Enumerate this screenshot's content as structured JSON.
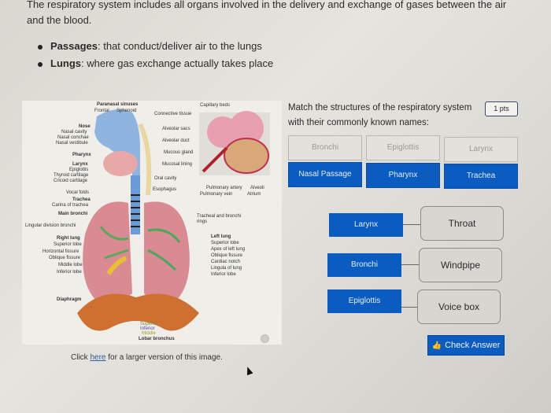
{
  "intro": {
    "paragraph": "The respiratory system includes all organs involved in the delivery and exchange of gases between the air and the blood.",
    "bullets": [
      {
        "term": "Passages",
        "text": ": that conduct/deliver air to the lungs"
      },
      {
        "term": "Lungs",
        "text": ": where gas exchange actually takes place"
      }
    ]
  },
  "diagram": {
    "labels": {
      "paranasal_sinuses": "Paranasal sinuses",
      "frontal": "Frontal",
      "sphenoid": "Sphenoid",
      "nose": "Nose",
      "nasal_cavity": "Nasal cavity",
      "nasal_conchae": "Nasal conchae",
      "nasal_vestibule": "Nasal vestibule",
      "pharynx": "Pharynx",
      "larynx": "Larynx",
      "epiglottis": "Epiglottis",
      "thyroid_cartilage": "Thyroid cartilage",
      "cricoid_cartilage": "Cricoid cartilage",
      "vocal_folds": "Vocal folds",
      "trachea": "Trachea",
      "carina": "Carina of trachea",
      "main_bronchi": "Main bronchi",
      "lingular_division": "Lingular division bronchi",
      "right_lung": "Right lung",
      "superior_lobe_r": "Superior lobe",
      "horizontal_fissure": "Horizontal fissure",
      "oblique_fissure_r": "Oblique fissure",
      "middle_lobe": "Middle lobe",
      "inferior_lobe_r": "Inferior lobe",
      "diaphragm": "Diaphragm",
      "connective_tissue": "Connective tissue",
      "alveolar_sacs": "Alveolar sacs",
      "alveolar_duct": "Alveolar duct",
      "mucous_gland": "Mucous gland",
      "mucosal_lining": "Mucosal lining",
      "oral_cavity": "Oral cavity",
      "esophagus": "Esophagus",
      "capillary_beds": "Capillary beds",
      "pulmonary_artery": "Pulmonary artery",
      "pulmonary_vein": "Pulmonary vein",
      "alveoli": "Alveoli",
      "atrium": "Atrium",
      "tracheal_rings": "Tracheal and bronchi rings",
      "left_lung": "Left lung",
      "superior_lobe_l": "Superior lobe",
      "apex": "Apex of left lung",
      "oblique_fissure_l": "Oblique fissure",
      "cardiac_notch": "Cardiac notch",
      "lingula": "Lingula of lung",
      "inferior_lobe_l": "Inferior lobe",
      "lobar_superior": "Superior",
      "lobar_inferior": "Inferior",
      "lobar_middle": "Middle",
      "lobar_bronchus": "Lobar bronchus"
    },
    "caption_prefix": "Click ",
    "caption_link": "here",
    "caption_suffix": " for a larger version of this image."
  },
  "question": {
    "text": "Match the structures of the respiratory system with their commonly known names:",
    "points": "1 pts",
    "pool": [
      {
        "label": "Bronchi",
        "state": "used"
      },
      {
        "label": "Epiglottis",
        "state": "used"
      },
      {
        "label": "Larynx",
        "state": "used"
      },
      {
        "label": "Nasal Passage",
        "state": "available"
      },
      {
        "label": "Pharynx",
        "state": "available"
      },
      {
        "label": "Trachea",
        "state": "available"
      }
    ],
    "matches": [
      {
        "answer": "Larynx",
        "target": "Throat"
      },
      {
        "answer": "Bronchi",
        "target": "Windpipe"
      },
      {
        "answer": "Epiglottis",
        "target": "Voice box"
      }
    ],
    "check_answer_label": "Check Answer",
    "check_icon": "thumbs-up-icon"
  },
  "colors": {
    "accent": "#0a5cc0",
    "used_tile": "#e3e1dc",
    "target_box": "#d8d6d1"
  }
}
